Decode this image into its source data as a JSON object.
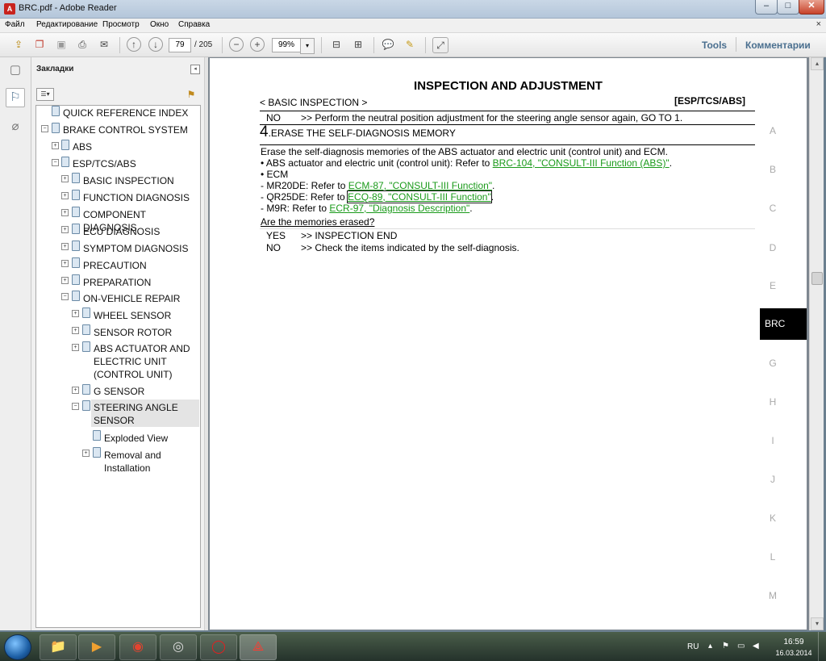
{
  "window": {
    "title": "BRC.pdf - Adobe Reader",
    "app_icon": "pdf-icon",
    "controls": {
      "minimize": "‒",
      "maximize": "□",
      "close": "✕"
    }
  },
  "menu": {
    "items": [
      "Файл",
      "Редактирование",
      "Просмотр",
      "Окно",
      "Справка"
    ],
    "close_glyph": "×"
  },
  "toolbar": {
    "page_current": "79",
    "page_total": "/ 205",
    "zoom": "99%",
    "zoom_dropdown": "▾",
    "tools_label": "Tools",
    "comments_label": "Комментарии",
    "icons": [
      "create-icon",
      "combine-icon",
      "save-icon",
      "print-icon",
      "email-icon",
      "prev-page-icon",
      "next-page-icon",
      "zoom-out-icon",
      "zoom-in-icon",
      "fit-page-icon",
      "fit-width-icon",
      "comment-icon",
      "highlight-icon",
      "expand-icon"
    ]
  },
  "sidebar": {
    "header": "Закладки",
    "collapse_glyph": "◂",
    "options_glyph": "☰▾",
    "icons": [
      "pages-icon",
      "bookmarks-icon",
      "attachments-icon"
    ],
    "bookmarks": [
      {
        "label": "QUICK REFERENCE INDEX",
        "toggle": ""
      },
      {
        "label": "BRAKE CONTROL SYSTEM",
        "toggle": "−"
      },
      {
        "label": "ABS",
        "toggle": "+"
      },
      {
        "label": "ESP/TCS/ABS",
        "toggle": "−"
      },
      {
        "label": "BASIC INSPECTION",
        "toggle": "+"
      },
      {
        "label": "FUNCTION DIAGNOSIS",
        "toggle": "+"
      },
      {
        "label": "COMPONENT DIAGNOSIS",
        "toggle": "+"
      },
      {
        "label": "ECU DIAGNOSIS",
        "toggle": "+"
      },
      {
        "label": "SYMPTOM DIAGNOSIS",
        "toggle": "+"
      },
      {
        "label": "PRECAUTION",
        "toggle": "+"
      },
      {
        "label": "PREPARATION",
        "toggle": "+"
      },
      {
        "label": "ON-VEHICLE REPAIR",
        "toggle": "−"
      },
      {
        "label": "WHEEL SENSOR",
        "toggle": "+"
      },
      {
        "label": "SENSOR ROTOR",
        "toggle": "+"
      },
      {
        "label": "ABS ACTUATOR AND",
        "toggle": "+"
      },
      {
        "label": "ELECTRIC UNIT",
        "toggle": ""
      },
      {
        "label": "(CONTROL UNIT)",
        "toggle": ""
      },
      {
        "label": "G SENSOR",
        "toggle": "+"
      },
      {
        "label": "STEERING ANGLE",
        "toggle": "−"
      },
      {
        "label": "SENSOR",
        "toggle": ""
      },
      {
        "label": "Exploded View",
        "toggle": ""
      },
      {
        "label": "Removal and",
        "toggle": "+"
      },
      {
        "label": "Installation",
        "toggle": ""
      }
    ]
  },
  "document": {
    "title": "INSPECTION AND ADJUSTMENT",
    "section": "< BASIC INSPECTION >",
    "section_code": "[ESP/TCS/ABS]",
    "prev_no_key": "NO",
    "prev_no_text": ">> Perform the neutral position adjustment for the steering angle sensor again, GO TO 1.",
    "step_number": "4",
    "step_title": ".ERASE THE SELF-DIAGNOSIS MEMORY",
    "line1": "Erase the self-diagnosis memories of the ABS actuator and electric unit (control unit) and ECM.",
    "line2_prefix": "• ABS actuator and electric unit (control unit): Refer to ",
    "line2_link": "BRC-104, \"CONSULT-III Function (ABS)\"",
    "line2_suffix": ".",
    "line3": "• ECM",
    "line4_prefix": "- MR20DE: Refer to ",
    "line4_link": "ECM-87, \"CONSULT-III Function\"",
    "line4_suffix": ".",
    "line5_prefix": "- QR25DE: Refer to ",
    "line5_link": "ECQ-89, \"CONSULT-III Function\"",
    "line5_suffix": ".",
    "line6_prefix": "- M9R: Refer to ",
    "line6_link": "ECR-97, \"Diagnosis Description\"",
    "line6_suffix": ".",
    "question": "Are the memories erased?",
    "yes_key": "YES",
    "yes_text": ">> INSPECTION END",
    "no_key": "NO",
    "no_text": ">> Check the items indicated by the self-diagnosis.",
    "index_letters": [
      "A",
      "B",
      "C",
      "D",
      "E",
      "G",
      "H",
      "I",
      "J",
      "K",
      "L",
      "M"
    ],
    "index_active": "BRC"
  },
  "scrollbar": {
    "up": "▴",
    "down": "▾"
  },
  "taskbar": {
    "apps": [
      "explorer-icon",
      "media-player-icon",
      "chrome-icon",
      "disc-icon",
      "opera-icon",
      "acrobat-icon"
    ],
    "tray_lang": "RU",
    "tray_icons": [
      "▴",
      "⚑",
      "▭",
      "◀"
    ],
    "time": "16:59",
    "date": "16.03.2014"
  }
}
